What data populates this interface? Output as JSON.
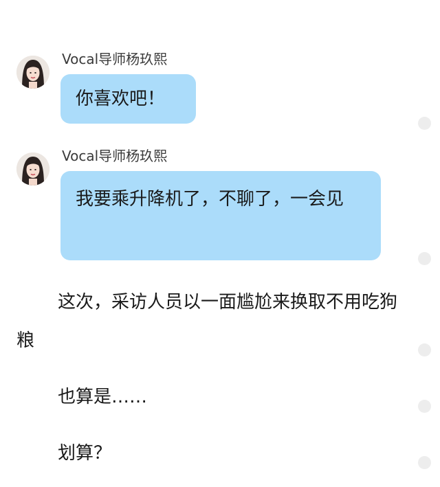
{
  "messages": [
    {
      "sender": "Vocal导师杨玖熙",
      "text": "你喜欢吧！",
      "avatar_icon": "woman-portrait-avatar"
    },
    {
      "sender": "Vocal导师杨玖熙",
      "text": "我要乘升降机了，不聊了，一会见",
      "avatar_icon": "woman-portrait-avatar"
    }
  ],
  "paragraphs": [
    "这次，采访人员以一面尴尬来换取不用吃狗粮",
    "也算是……",
    "划算？"
  ],
  "colors": {
    "bubble": "#abdcfa",
    "background": "#ffffff",
    "side_dot": "#ededed"
  }
}
